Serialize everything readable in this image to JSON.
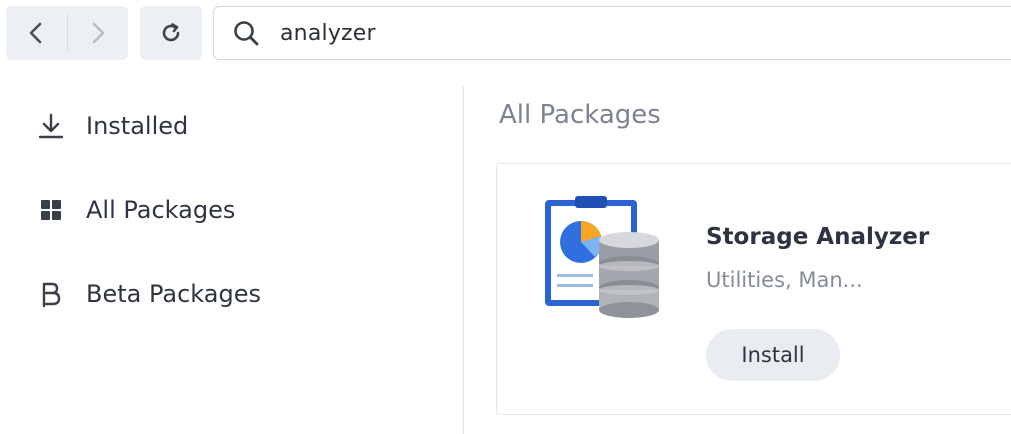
{
  "toolbar": {
    "back_icon": "chevron-left-icon",
    "forward_icon": "chevron-right-icon",
    "refresh_icon": "refresh-icon",
    "search_value": "analyzer"
  },
  "sidebar": {
    "items": [
      {
        "label": "Installed",
        "icon": "download-icon"
      },
      {
        "label": "All Packages",
        "icon": "grid-icon"
      },
      {
        "label": "Beta Packages",
        "icon": "beta-icon"
      }
    ]
  },
  "main": {
    "section_title": "All Packages",
    "packages": [
      {
        "name": "Storage Analyzer",
        "category": "Utilities, Man...",
        "action": "Install",
        "icon": "storage-analyzer-icon"
      }
    ]
  },
  "colors": {
    "toolbar_bg": "#eceff3",
    "button_bg": "#e9ecf1",
    "muted_text": "#7d848f",
    "accent_blue": "#2f6fe0"
  }
}
